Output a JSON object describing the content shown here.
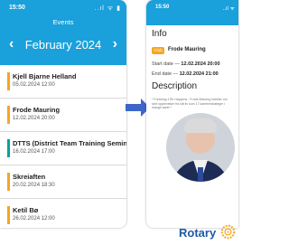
{
  "left_phone": {
    "status_time": "15:50",
    "status_icons": "..ıl ᯤ ▮",
    "title": "Events",
    "month": "February 2024",
    "prev_icon": "chevron-left-icon",
    "next_icon": "chevron-right-icon",
    "events": [
      {
        "name": "Kjell Bjarne Helland",
        "date": "05.02.2024 12:00",
        "color": "#f5a623"
      },
      {
        "name": "Frode Mauring",
        "date": "12.02.2024 20:00",
        "color": "#f5a623"
      },
      {
        "name": "DTTS (District Team Training Semina",
        "date": "16.02.2024 17:00",
        "color": "#0aa19a"
      },
      {
        "name": "Skreiaften",
        "date": "20.02.2024 18:30",
        "color": "#f5a623"
      },
      {
        "name": "Ketil Bø",
        "date": "26.02.2024 12:00",
        "color": "#f5a623"
      }
    ]
  },
  "right_phone": {
    "status_time": "15:50",
    "status_icons": "..ıl ᯤ",
    "info_heading": "Info",
    "chip": "Club",
    "event_name": "Frode Mauring",
    "start_label": "Start date",
    "start_value": "12.02.2024 20:00",
    "end_label": "End date",
    "end_value": "12.02.2024 21:00",
    "description_heading": "Description",
    "description_text": "* Foredrag 17th Happens - Frode Mauring forteller om sine opplevelser fra sitt liv som 17 karrierestrateger i mange aarer *"
  },
  "rotary_text": "Rotary",
  "colors": {
    "header_blue": "#1aa0db",
    "arrow_blue": "#3d66c8",
    "rotary_blue": "#1d5aa7",
    "rotary_gold": "#f7a81b"
  }
}
